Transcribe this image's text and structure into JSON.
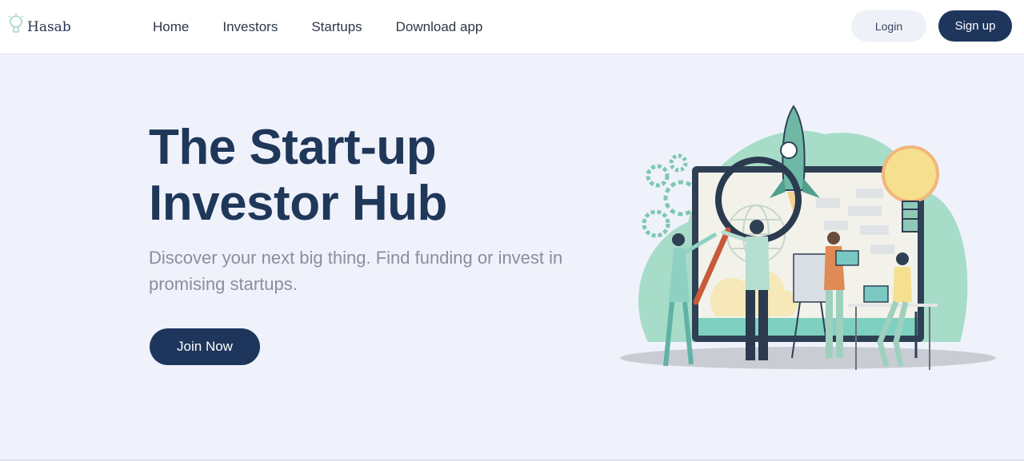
{
  "brand": {
    "name": "Hasab",
    "icon": "lightbulb-icon"
  },
  "nav": {
    "items": [
      "Home",
      "Investors",
      "Startups",
      "Download app"
    ]
  },
  "auth": {
    "login_label": "Login",
    "signup_label": "Sign up"
  },
  "hero": {
    "title_line1": "The Start-up",
    "title_line2": "Investor Hub",
    "subtitle": "Discover your next big thing. Find funding or invest in promising startups.",
    "cta_label": "Join Now"
  },
  "colors": {
    "primary": "#1f365c",
    "background": "#eff2fb",
    "accent_teal": "#9fd6c3",
    "accent_yellow": "#f6df8f"
  },
  "illustration": {
    "name": "startup-team-rocket-illustration"
  }
}
